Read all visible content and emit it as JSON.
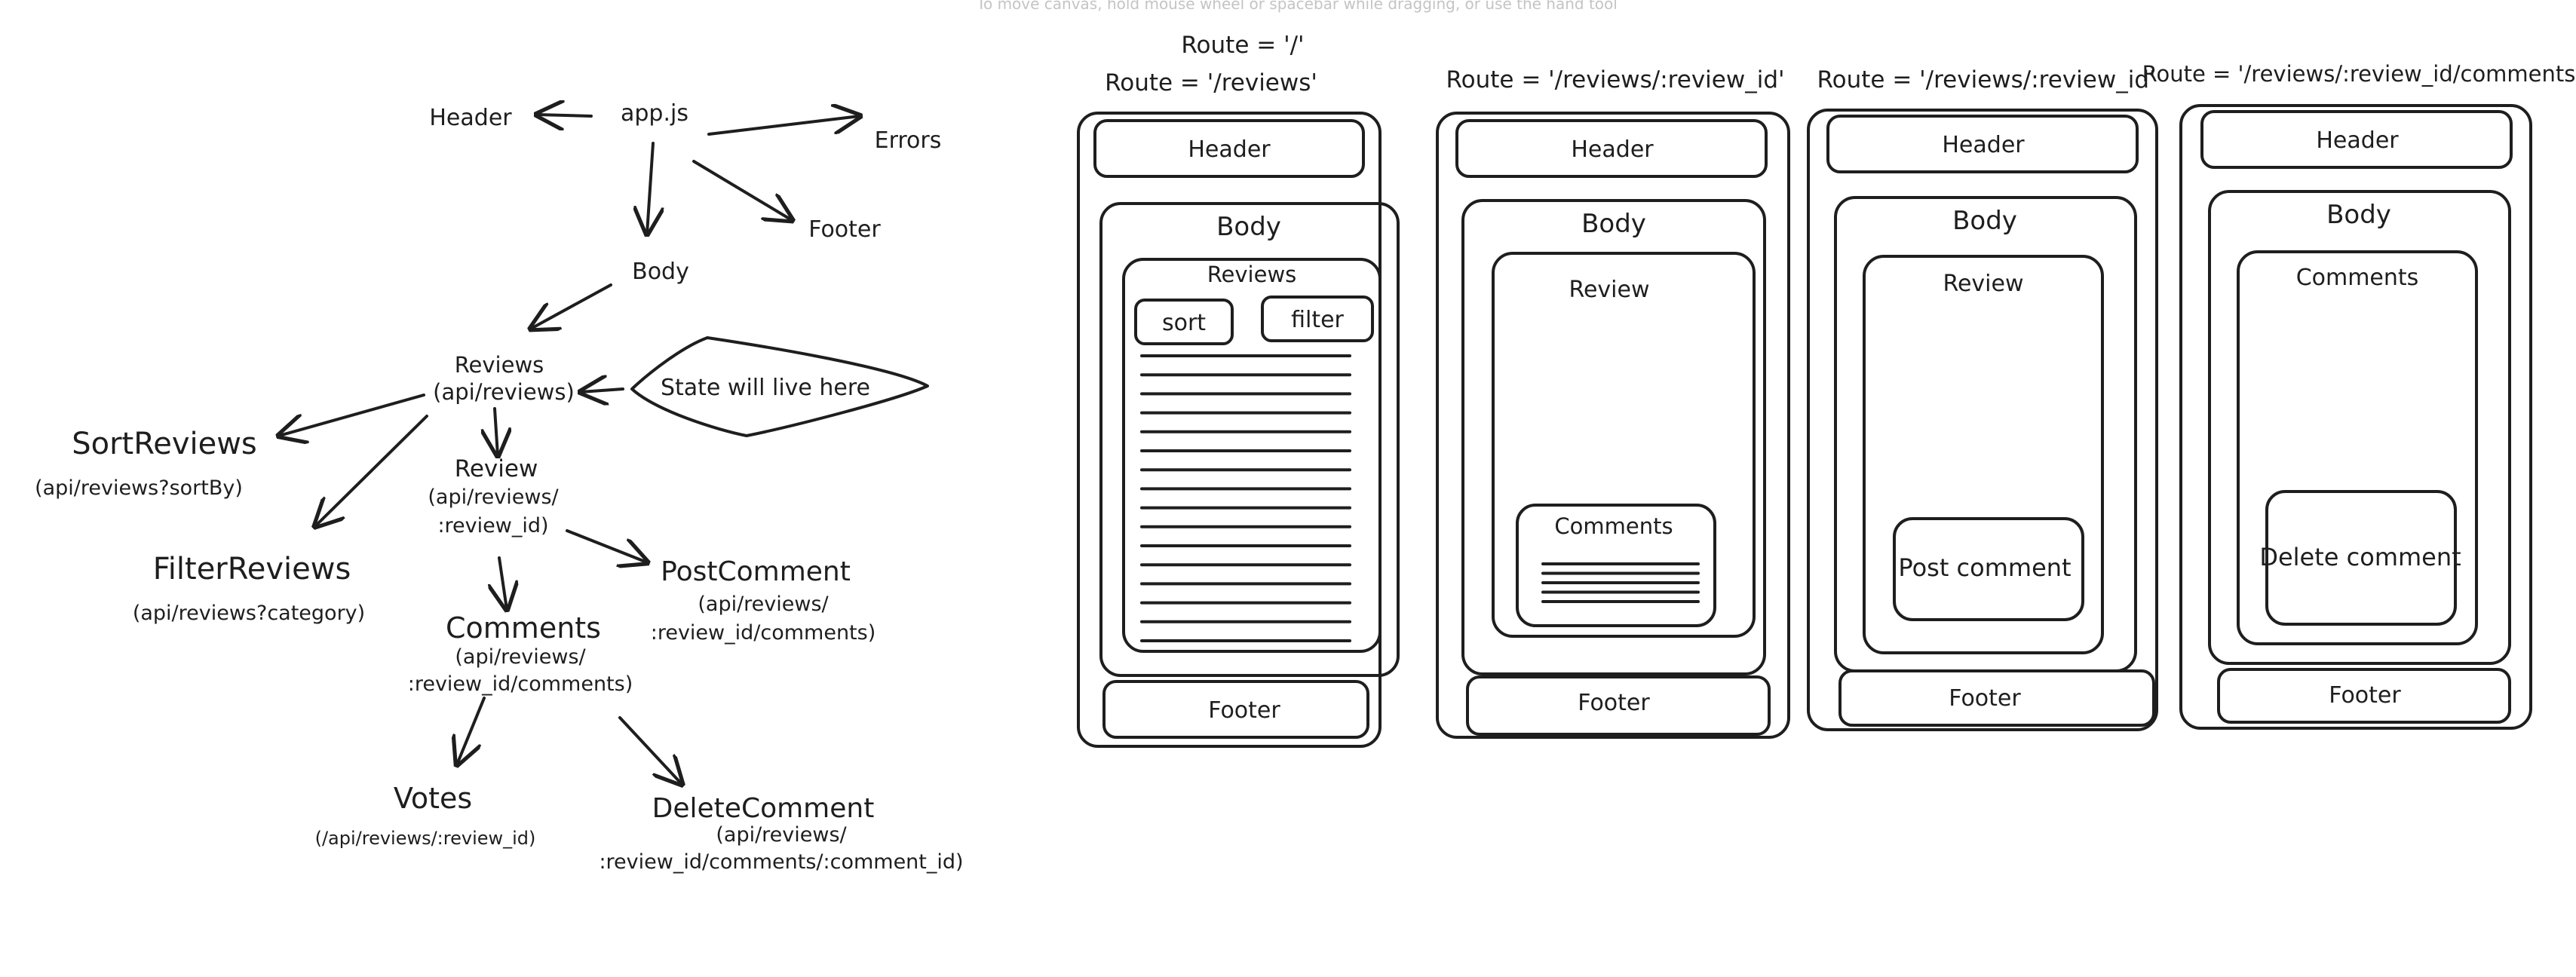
{
  "canvas_hint": "To move canvas, hold mouse wheel or spacebar while dragging, or use the hand tool",
  "tree": {
    "app": "app.js",
    "header": "Header",
    "errors": "Errors",
    "footer": "Footer",
    "body": "Body",
    "reviews": {
      "title": "Reviews",
      "api": "(api/reviews)"
    },
    "state_note": "State will live here",
    "sort_reviews": {
      "title": "SortReviews",
      "api": "(api/reviews?sortBy)"
    },
    "filter_reviews": {
      "title": "FilterReviews",
      "api": "(api/reviews?category)"
    },
    "review": {
      "title": "Review",
      "api_1": "(api/reviews/",
      "api_2": ":review_id)"
    },
    "post_comment": {
      "title": "PostComment",
      "api_1": "(api/reviews/",
      "api_2": ":review_id/comments)"
    },
    "comments": {
      "title": "Comments",
      "api_1": "(api/reviews/",
      "api_2": ":review_id/comments)"
    },
    "votes": {
      "title": "Votes",
      "api": "(/api/reviews/:review_id)"
    },
    "delete_comment": {
      "title": "DeleteComment",
      "api_1": "(api/reviews/",
      "api_2": ":review_id/comments/:comment_id)"
    }
  },
  "wireframes": {
    "route_root": "Route = '/'",
    "route_reviews": "Route = '/reviews'",
    "route_review_id_a": "Route = '/reviews/:review_id'",
    "route_review_id_b": "Route = '/reviews/:review_id'",
    "route_comments": "Route = '/reviews/:review_id/comments'",
    "header": "Header",
    "body": "Body",
    "footer": "Footer",
    "reviews": "Reviews",
    "sort": "sort",
    "filter": "filter",
    "review": "Review",
    "comments": "Comments",
    "post_comment": "Post comment",
    "delete_comment": "Delete comment"
  }
}
